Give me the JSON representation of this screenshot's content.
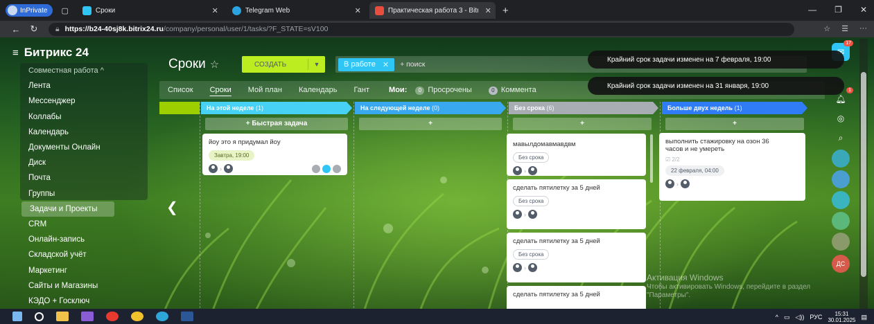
{
  "browser": {
    "inprivate_label": "InPrivate",
    "tabs": [
      {
        "label": "Сроки"
      },
      {
        "label": "Telegram Web"
      },
      {
        "label": "Практическая работа 3 - Bitrix24"
      }
    ],
    "url_host": "https://b24-40sj8k.bitrix24.ru",
    "url_path": "/company/personal/user/1/tasks/?F_STATE=sV100"
  },
  "app": {
    "logo": "Битрикс 24",
    "menu": [
      {
        "label": "Совместная работа ^",
        "type": "head"
      },
      {
        "label": "Лента"
      },
      {
        "label": "Мессенджер"
      },
      {
        "label": "Коллабы"
      },
      {
        "label": "Календарь"
      },
      {
        "label": "Документы Онлайн"
      },
      {
        "label": "Диск"
      },
      {
        "label": "Почта"
      },
      {
        "label": "Группы"
      },
      {
        "label": "Задачи и Проекты",
        "type": "selected"
      },
      {
        "label": "CRM"
      },
      {
        "label": "Онлайн-запись"
      },
      {
        "label": "Складской учёт"
      },
      {
        "label": "Маркетинг"
      },
      {
        "label": "Сайты и Магазины"
      },
      {
        "label": "КЭДО + Госключ"
      }
    ]
  },
  "header": {
    "title": "Сроки",
    "create_label": "СОЗДАТЬ",
    "filter_chip": "В работе",
    "search_placeholder": "+ поиск"
  },
  "views": {
    "tabs": [
      "Список",
      "Сроки",
      "Мой план",
      "Календарь",
      "Гант"
    ],
    "active": "Сроки",
    "my_label": "Мои:",
    "overdue_count": "0",
    "overdue_label": "Просрочены",
    "comments_count": "0",
    "comments_label": "Коммента"
  },
  "toasts": [
    "Крайний срок задачи изменен на 7 февраля, 19:00",
    "Крайний срок задачи изменен на 31 января, 19:00"
  ],
  "columns": [
    {
      "title": "На этой неделе",
      "count": "(1)",
      "color": "#47d1f5",
      "quick_add": "+ Быстрая задача"
    },
    {
      "title": "На следующей неделе",
      "count": "(0)",
      "color": "#39a8ef",
      "quick_add": "+"
    },
    {
      "title": "Без срока",
      "count": "(6)",
      "color": "#a8adb4",
      "quick_add": "+"
    },
    {
      "title": "Больше двух недель",
      "count": "(1)",
      "color": "#2f7cf6",
      "quick_add": "+"
    }
  ],
  "cards": {
    "c1": {
      "title": "йоу это я придумал йоу",
      "deadline": "Завтра, 19:00"
    },
    "c2": {
      "title": "мавылдомавмавдвм",
      "deadline": "Без срока"
    },
    "c3": {
      "title": "сделать пятилетку за 5 дней",
      "deadline": "Без срока"
    },
    "c4": {
      "title": "сделать пятилетку за 5 дней",
      "deadline": "Без срока"
    },
    "c5": {
      "title": "сделать пятилетку за 5 дней"
    },
    "c6": {
      "title": "выполнить стажировку на озон 36 часов и не умереть",
      "checklist": "☑ 2/2",
      "deadline": "22 февраля, 04:00"
    }
  },
  "right_panel": {
    "notif_count": "17",
    "bell_count": "1",
    "user_initials": "ДС"
  },
  "windows": {
    "activate_title": "Активация Windows",
    "activate_text": "Чтобы активировать Windows, перейдите в раздел \"Параметры\".",
    "lang": "РУС",
    "time": "15:31",
    "date": "30.01.2025"
  }
}
